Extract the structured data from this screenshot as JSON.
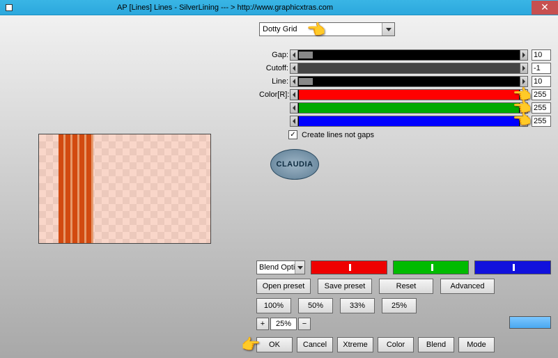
{
  "titlebar": {
    "title": "AP [Lines]  Lines - SilverLining    --- >  http://www.graphicxtras.com"
  },
  "preset": {
    "selected": "Dotty Grid"
  },
  "sliders": {
    "gap": {
      "label": "Gap:",
      "value": "10"
    },
    "cutoff": {
      "label": "Cutoff:",
      "value": "-1"
    },
    "line": {
      "label": "Line:",
      "value": "10"
    },
    "colorR": {
      "label": "Color[R]:",
      "value": "255"
    },
    "colorG": {
      "label": "",
      "value": "255"
    },
    "colorB": {
      "label": "",
      "value": "255"
    }
  },
  "create_lines_label": "Create lines not gaps",
  "badge": "CLAUDIA",
  "blend_option": "Blend Opti",
  "buttons": {
    "open_preset": "Open preset",
    "save_preset": "Save preset",
    "reset": "Reset",
    "advanced": "Advanced",
    "p100": "100%",
    "p50": "50%",
    "p33": "33%",
    "p25": "25%",
    "ok": "OK",
    "cancel": "Cancel",
    "xtreme": "Xtreme",
    "color": "Color",
    "blend": "Blend",
    "mode": "Mode"
  },
  "stepper": {
    "value": "25%"
  }
}
